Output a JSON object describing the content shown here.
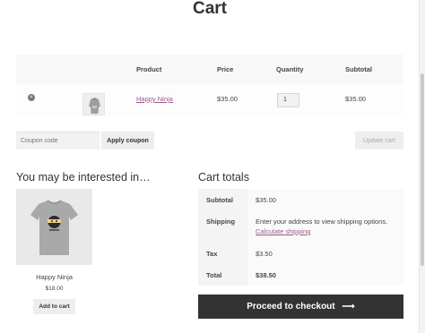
{
  "page": {
    "title": "Cart"
  },
  "cart": {
    "headers": {
      "product": "Product",
      "price": "Price",
      "quantity": "Quantity",
      "subtotal": "Subtotal"
    },
    "items": [
      {
        "name": "Happy Ninja",
        "price": "$35.00",
        "quantity": "1",
        "subtotal": "$35.00",
        "thumbnail_icon": "hoodie-thumbnail",
        "remove_icon": "remove-icon"
      }
    ],
    "coupon_placeholder": "Coupon code",
    "apply_coupon_label": "Apply coupon",
    "update_cart_label": "Update cart"
  },
  "cross_sells": {
    "heading": "You may be interested in…",
    "products": [
      {
        "name": "Happy Ninja",
        "price": "$18.00",
        "button": "Add to cart",
        "image_icon": "tshirt-image"
      }
    ]
  },
  "totals": {
    "heading": "Cart totals",
    "subtotal_label": "Subtotal",
    "subtotal_value": "$35.00",
    "shipping_label": "Shipping",
    "shipping_text": "Enter your address to view shipping options.",
    "shipping_link": "Calculate shipping",
    "tax_label": "Tax",
    "tax_value": "$3.50",
    "total_label": "Total",
    "total_value": "$38.50",
    "checkout_label": "Proceed to checkout",
    "checkout_icon": "arrow-right-icon"
  },
  "colors": {
    "link": "#96588a",
    "checkout_bg": "#333333",
    "button_bg": "#eeeeee"
  }
}
